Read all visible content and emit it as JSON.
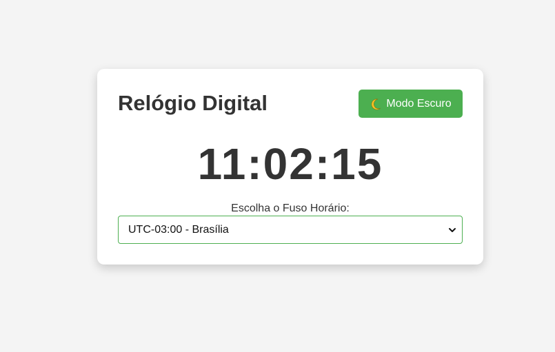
{
  "app": {
    "title": "Relógio Digital"
  },
  "theme_toggle": {
    "icon": "moon-icon",
    "label": "Modo Escuro"
  },
  "clock": {
    "time": "11:02:15"
  },
  "timezone": {
    "label": "Escolha o Fuso Horário:",
    "selected": "UTC-03:00 - Brasília"
  },
  "colors": {
    "accent": "#4caf50",
    "text": "#333333",
    "background": "#f4f4f4",
    "card": "#ffffff"
  }
}
